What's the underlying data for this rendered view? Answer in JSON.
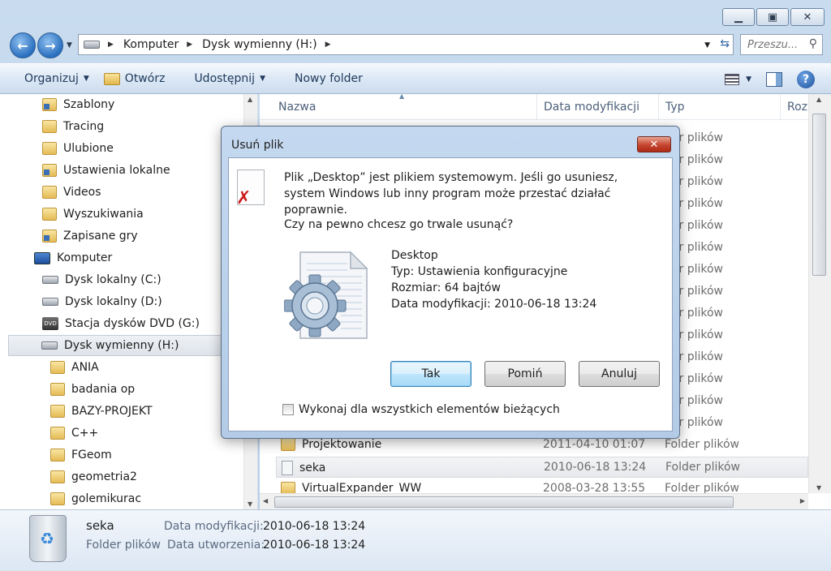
{
  "address": {
    "crumbs": [
      "Komputer",
      "Dysk wymienny (H:)"
    ],
    "search_placeholder": "Przeszu..."
  },
  "toolbar": {
    "organize": "Organizuj",
    "open": "Otwórz",
    "share": "Udostępnij",
    "new_folder": "Nowy folder"
  },
  "nav": {
    "items": [
      {
        "label": "Szablony",
        "icon": "special-folder-icon"
      },
      {
        "label": "Tracing",
        "icon": "folder-icon"
      },
      {
        "label": "Ulubione",
        "icon": "folder-icon"
      },
      {
        "label": "Ustawienia lokalne",
        "icon": "special-folder-icon"
      },
      {
        "label": "Videos",
        "icon": "folder-icon"
      },
      {
        "label": "Wyszukiwania",
        "icon": "folder-icon"
      },
      {
        "label": "Zapisane gry",
        "icon": "special-folder-icon"
      },
      {
        "label": "Komputer",
        "icon": "computer-icon"
      },
      {
        "label": "Dysk lokalny (C:)",
        "icon": "drive-icon"
      },
      {
        "label": "Dysk lokalny (D:)",
        "icon": "drive-icon"
      },
      {
        "label": "Stacja dysków DVD (G:)",
        "icon": "dvd-icon"
      },
      {
        "label": "Dysk wymienny (H:)",
        "icon": "drive-icon"
      },
      {
        "label": "ANIA",
        "icon": "folder-icon"
      },
      {
        "label": "badania op",
        "icon": "folder-icon"
      },
      {
        "label": "BAZY-PROJEKT",
        "icon": "folder-icon"
      },
      {
        "label": "C++",
        "icon": "folder-icon"
      },
      {
        "label": "FGeom",
        "icon": "folder-icon"
      },
      {
        "label": "geometria2",
        "icon": "folder-icon"
      },
      {
        "label": "golemikurac",
        "icon": "folder-icon"
      }
    ]
  },
  "columns": {
    "name": "Nazwa",
    "modified": "Data modyfikacji",
    "type": "Typ",
    "size": "Roz"
  },
  "files": {
    "partial_type": "der plików",
    "rows": [
      {
        "name": "Projektowanie",
        "date": "2011-04-10 01:07",
        "type": "Folder plików"
      },
      {
        "name": "seka",
        "date": "2010-06-18 13:24",
        "type": "Folder plików"
      },
      {
        "name": "VirtualExpander_WW",
        "date": "2008-03-28 13:55",
        "type": "Folder plików"
      }
    ]
  },
  "details": {
    "name": "seka",
    "type": "Folder plików",
    "modified_label": "Data modyfikacji:",
    "modified_value": "2010-06-18 13:24",
    "created_label": "Data utworzenia:",
    "created_value": "2010-06-18 13:24"
  },
  "dialog": {
    "title": "Usuń plik",
    "message": "Plik „Desktop” jest plikiem systemowym. Jeśli go usuniesz, system Windows lub inny program może przestać działać poprawnie.",
    "question": "Czy na pewno chcesz go trwale usunąć?",
    "file_name": "Desktop",
    "file_type": "Typ: Ustawienia konfiguracyjne",
    "file_size": "Rozmiar: 64 bajtów",
    "file_modified": "Data modyfikacji: 2010-06-18 13:24",
    "yes": "Tak",
    "skip": "Pomiń",
    "cancel": "Anuluj",
    "apply_all": "Wykonaj dla wszystkich elementów bieżących"
  }
}
